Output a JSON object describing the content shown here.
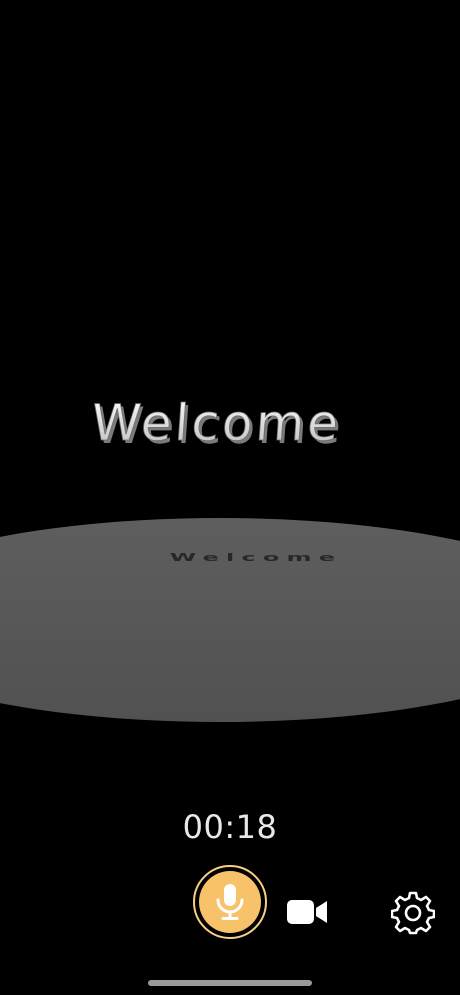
{
  "scene": {
    "text_3d": "Welcome",
    "reflection_text": "Welcome"
  },
  "recording": {
    "timer": "00:18"
  },
  "controls": {
    "mic": {
      "icon": "microphone-icon",
      "active": true
    },
    "video": {
      "icon": "video-camera-icon"
    },
    "settings": {
      "icon": "gear-icon"
    }
  },
  "colors": {
    "accent": "#f7c26a",
    "accent_ring": "#f7cf86",
    "background": "#000000",
    "platform": "#585858"
  }
}
